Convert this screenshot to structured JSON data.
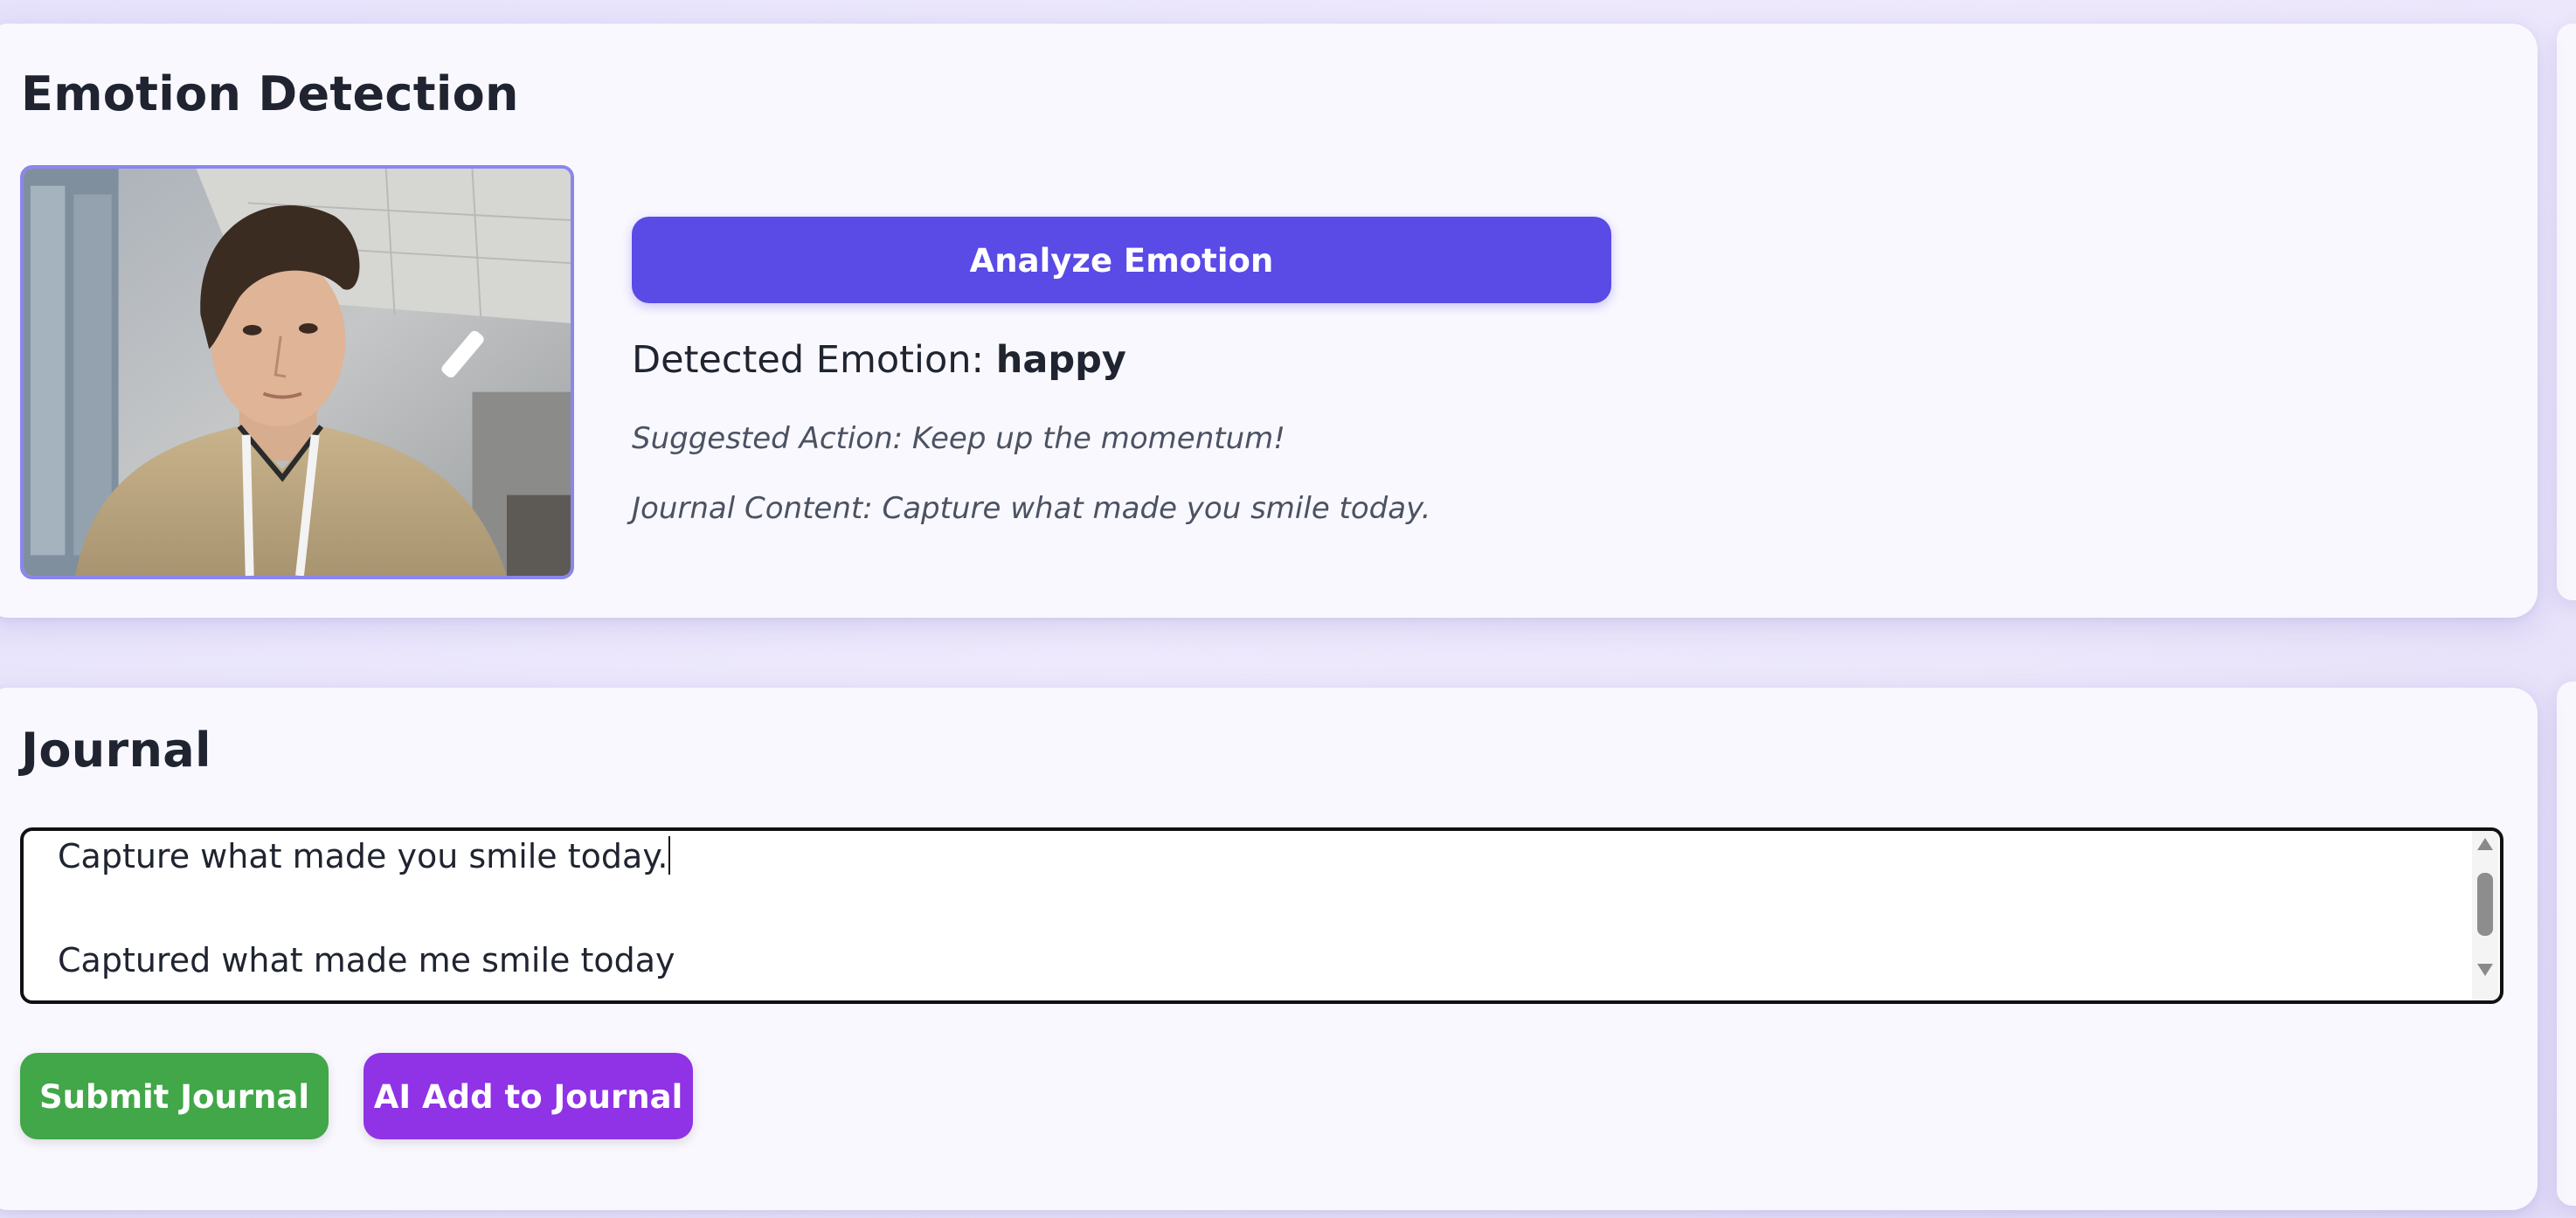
{
  "emotion_card": {
    "title": "Emotion Detection",
    "analyze_button": "Analyze Emotion",
    "detected_label": "Detected Emotion:",
    "detected_value": "happy",
    "suggested_action": "Suggested Action: Keep up the momentum!",
    "journal_content": "Journal Content: Capture what made you smile today."
  },
  "journal_card": {
    "title": "Journal",
    "textarea_lines": [
      "Capture what made you smile today.",
      "Captured what made me smile today"
    ],
    "submit_button": "Submit Journal",
    "ai_button": "AI Add to Journal"
  },
  "colors": {
    "analyze_button": "#5a4ae6",
    "submit_button": "#41a748",
    "ai_button": "#9032e6",
    "webcam_border": "#8b86ee"
  },
  "icons": {
    "scroll_up": "triangle-up",
    "scroll_down": "triangle-down"
  }
}
